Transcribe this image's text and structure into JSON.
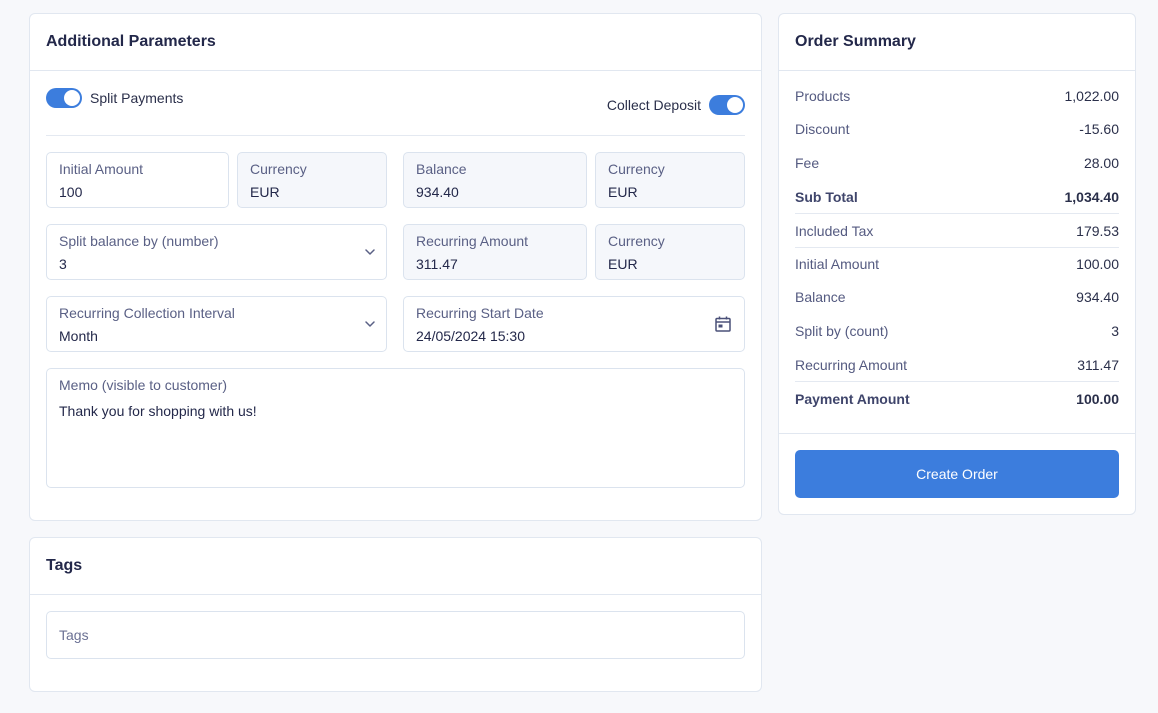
{
  "params": {
    "title": "Additional Parameters",
    "split_payments": {
      "label": "Split Payments",
      "enabled": true
    },
    "collect_deposit": {
      "label": "Collect Deposit",
      "enabled": true
    },
    "fields": {
      "initial_amount": {
        "label": "Initial Amount",
        "value": "100"
      },
      "initial_currency": {
        "label": "Currency",
        "value": "EUR"
      },
      "balance": {
        "label": "Balance",
        "value": "934.40"
      },
      "balance_currency": {
        "label": "Currency",
        "value": "EUR"
      },
      "split_by": {
        "label": "Split balance by (number)",
        "value": "3"
      },
      "recurring_amount": {
        "label": "Recurring Amount",
        "value": "311.47"
      },
      "recurring_currency": {
        "label": "Currency",
        "value": "EUR"
      },
      "interval": {
        "label": "Recurring Collection Interval",
        "value": "Month"
      },
      "start_date": {
        "label": "Recurring Start Date",
        "value": "24/05/2024 15:30"
      },
      "memo": {
        "label": "Memo (visible to customer)",
        "value": "Thank you for shopping with us!"
      }
    },
    "icons": {
      "chevron": "chevron-down-icon",
      "calendar": "calendar-icon"
    }
  },
  "tags": {
    "title": "Tags",
    "placeholder": "Tags"
  },
  "summary": {
    "title": "Order Summary",
    "rows": [
      {
        "label": "Products",
        "value": "1,022.00"
      },
      {
        "label": "Discount",
        "value": "-15.60"
      },
      {
        "label": "Fee",
        "value": "28.00"
      },
      {
        "label": "Sub Total",
        "value": "1,034.40"
      },
      {
        "label": "Included Tax",
        "value": "179.53"
      },
      {
        "label": "Initial Amount",
        "value": "100.00"
      },
      {
        "label": "Balance",
        "value": "934.40"
      },
      {
        "label": "Split by (count)",
        "value": "3"
      },
      {
        "label": "Recurring Amount",
        "value": "311.47"
      },
      {
        "label": "Payment Amount",
        "value": "100.00"
      }
    ],
    "create_button": "Create Order"
  },
  "colors": {
    "accent": "#3c7ddd",
    "background": "#f7f8fb",
    "border": "#e1e7f0",
    "text": "#23284a",
    "muted_text": "#5a6085"
  }
}
